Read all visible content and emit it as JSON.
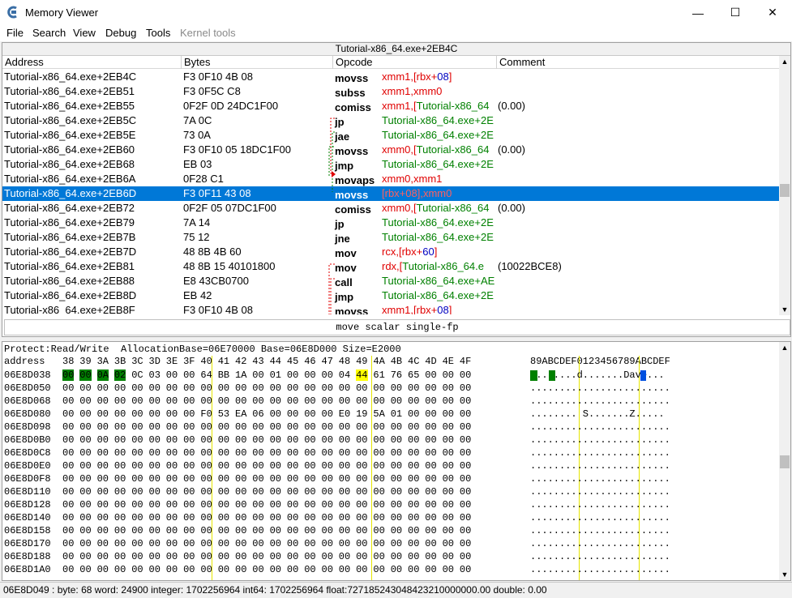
{
  "window": {
    "title": "Memory Viewer",
    "minimize": "—",
    "maximize": "☐",
    "close": "✕"
  },
  "menu": [
    "File",
    "Search",
    "View",
    "Debug",
    "Tools",
    "Kernel tools"
  ],
  "disasm": {
    "address_header": "Tutorial-x86_64.exe+2EB4C",
    "columns": [
      "Address",
      "Bytes",
      "Opcode",
      "Comment"
    ],
    "rows": [
      {
        "addr": "Tutorial-x86_64.exe+2EB4C",
        "bytes": "F3 0F10 4B 08",
        "op": "movss",
        "args": [
          {
            "t": "xmm1",
            "c": "red"
          },
          {
            "t": ",[",
            "c": "red"
          },
          {
            "t": "rbx",
            "c": "red"
          },
          {
            "t": "+",
            "c": "red"
          },
          {
            "t": "08",
            "c": "blue"
          },
          {
            "t": "]",
            "c": "red"
          }
        ],
        "rest": ""
      },
      {
        "addr": "Tutorial-x86_64.exe+2EB51",
        "bytes": "F3 0F5C C8",
        "op": "subss",
        "args": [
          {
            "t": "xmm1,xmm0",
            "c": "red"
          }
        ],
        "rest": ""
      },
      {
        "addr": "Tutorial-x86_64.exe+2EB55",
        "bytes": "0F2F 0D 24DC1F00",
        "op": "comiss",
        "args": [
          {
            "t": "xmm1,[",
            "c": "red"
          },
          {
            "t": "Tutorial-x86_64",
            "c": "green"
          }
        ],
        "rest": "(0.00)"
      },
      {
        "addr": "Tutorial-x86_64.exe+2EB5C",
        "bytes": "7A 0C",
        "op": "jp",
        "args": [
          {
            "t": "Tutorial-x86_64.exe+2E",
            "c": "green"
          }
        ],
        "rest": ""
      },
      {
        "addr": "Tutorial-x86_64.exe+2EB5E",
        "bytes": "73 0A",
        "op": "jae",
        "args": [
          {
            "t": "Tutorial-x86_64.exe+2E",
            "c": "green"
          }
        ],
        "rest": ""
      },
      {
        "addr": "Tutorial-x86_64.exe+2EB60",
        "bytes": "F3 0F10 05 18DC1F00",
        "op": "movss",
        "args": [
          {
            "t": "xmm0,[",
            "c": "red"
          },
          {
            "t": "Tutorial-x86_64",
            "c": "green"
          }
        ],
        "rest": "(0.00)"
      },
      {
        "addr": "Tutorial-x86_64.exe+2EB68",
        "bytes": "EB 03",
        "op": "jmp",
        "args": [
          {
            "t": "Tutorial-x86_64.exe+2E",
            "c": "green"
          }
        ],
        "rest": ""
      },
      {
        "addr": "Tutorial-x86_64.exe+2EB6A",
        "bytes": "0F28 C1",
        "op": "movaps",
        "args": [
          {
            "t": " xmm0,xmm1",
            "c": "red"
          }
        ],
        "rest": ""
      },
      {
        "addr": "Tutorial-x86_64.exe+2EB6D",
        "bytes": "F3 0F11 43 08",
        "op": "movss",
        "args": [
          {
            "t": "[rbx+08],xmm0",
            "c": "red"
          }
        ],
        "rest": "",
        "selected": true
      },
      {
        "addr": "Tutorial-x86_64.exe+2EB72",
        "bytes": "0F2F 05 07DC1F00",
        "op": "comiss",
        "args": [
          {
            "t": "xmm0,[",
            "c": "red"
          },
          {
            "t": "Tutorial-x86_64",
            "c": "green"
          }
        ],
        "rest": "(0.00)"
      },
      {
        "addr": "Tutorial-x86_64.exe+2EB79",
        "bytes": "7A 14",
        "op": "jp",
        "args": [
          {
            "t": "Tutorial-x86_64.exe+2E",
            "c": "green"
          }
        ],
        "rest": ""
      },
      {
        "addr": "Tutorial-x86_64.exe+2EB7B",
        "bytes": "75 12",
        "op": "jne",
        "args": [
          {
            "t": "Tutorial-x86_64.exe+2E",
            "c": "green"
          }
        ],
        "rest": ""
      },
      {
        "addr": "Tutorial-x86_64.exe+2EB7D",
        "bytes": "48 8B 4B 60",
        "op": "mov",
        "args": [
          {
            "t": "rcx,[",
            "c": "red"
          },
          {
            "t": "rbx",
            "c": "red"
          },
          {
            "t": "+",
            "c": "red"
          },
          {
            "t": "60",
            "c": "blue"
          },
          {
            "t": "]",
            "c": "red"
          }
        ],
        "rest": ""
      },
      {
        "addr": "Tutorial-x86_64.exe+2EB81",
        "bytes": "48 8B 15 40101800",
        "op": "mov",
        "args": [
          {
            "t": "rdx,[",
            "c": "red"
          },
          {
            "t": "Tutorial-x86_64.e",
            "c": "green"
          }
        ],
        "rest": "(10022BCE8)"
      },
      {
        "addr": "Tutorial-x86_64.exe+2EB88",
        "bytes": "E8 43CB0700",
        "op": "call",
        "args": [
          {
            "t": "Tutorial-x86_64.exe+AE",
            "c": "green"
          }
        ],
        "rest": ""
      },
      {
        "addr": "Tutorial-x86_64.exe+2EB8D",
        "bytes": "EB 42",
        "op": "jmp",
        "args": [
          {
            "t": "Tutorial-x86_64.exe+2E",
            "c": "green"
          }
        ],
        "rest": ""
      },
      {
        "addr": "Tutorial-x86_64.exe+2EB8F",
        "bytes": "F3 0F10 4B 08",
        "op": "movss",
        "args": [
          {
            "t": "xmm1,[",
            "c": "red"
          },
          {
            "t": "rbx",
            "c": "red"
          },
          {
            "t": "+",
            "c": "red"
          },
          {
            "t": "08",
            "c": "blue"
          },
          {
            "t": "]",
            "c": "red"
          }
        ],
        "rest": ""
      }
    ],
    "description": "move scalar single-fp"
  },
  "hexview": {
    "info": "Protect:Read/Write  AllocationBase=06E70000 Base=06E8D000 Size=E2000",
    "header_label": "address",
    "header_bytes": [
      "38",
      "39",
      "3A",
      "3B",
      "3C",
      "3D",
      "3E",
      "3F",
      "40",
      "41",
      "42",
      "43",
      "44",
      "45",
      "46",
      "47",
      "48",
      "49",
      "4A",
      "4B",
      "4C",
      "4D",
      "4E",
      "4F"
    ],
    "header_chars": "89ABCDEF0123456789ABCDEF",
    "rows": [
      {
        "addr": "06E8D038",
        "bytes": [
          "00",
          "00",
          "0A",
          "02",
          "0C",
          "03",
          "00",
          "00",
          "64",
          "BB",
          "1A",
          "00",
          "01",
          "00",
          "00",
          "00",
          "04",
          "44",
          "61",
          "76",
          "65",
          "00",
          "00",
          "00"
        ],
        "chars": "........d.......Dave..."
      },
      {
        "addr": "06E8D050",
        "bytes": [
          "00",
          "00",
          "00",
          "00",
          "00",
          "00",
          "00",
          "00",
          "00",
          "00",
          "00",
          "00",
          "00",
          "00",
          "00",
          "00",
          "00",
          "00",
          "00",
          "00",
          "00",
          "00",
          "00",
          "00"
        ],
        "chars": "........................"
      },
      {
        "addr": "06E8D068",
        "bytes": [
          "00",
          "00",
          "00",
          "00",
          "00",
          "00",
          "00",
          "00",
          "00",
          "00",
          "00",
          "00",
          "00",
          "00",
          "00",
          "00",
          "00",
          "00",
          "00",
          "00",
          "00",
          "00",
          "00",
          "00"
        ],
        "chars": "........................"
      },
      {
        "addr": "06E8D080",
        "bytes": [
          "00",
          "00",
          "00",
          "00",
          "00",
          "00",
          "00",
          "00",
          "F0",
          "53",
          "EA",
          "06",
          "00",
          "00",
          "00",
          "00",
          "E0",
          "19",
          "5A",
          "01",
          "00",
          "00",
          "00",
          "00"
        ],
        "chars": "........ S.......Z....."
      },
      {
        "addr": "06E8D098",
        "bytes": [
          "00",
          "00",
          "00",
          "00",
          "00",
          "00",
          "00",
          "00",
          "00",
          "00",
          "00",
          "00",
          "00",
          "00",
          "00",
          "00",
          "00",
          "00",
          "00",
          "00",
          "00",
          "00",
          "00",
          "00"
        ],
        "chars": "........................"
      },
      {
        "addr": "06E8D0B0",
        "bytes": [
          "00",
          "00",
          "00",
          "00",
          "00",
          "00",
          "00",
          "00",
          "00",
          "00",
          "00",
          "00",
          "00",
          "00",
          "00",
          "00",
          "00",
          "00",
          "00",
          "00",
          "00",
          "00",
          "00",
          "00"
        ],
        "chars": "........................"
      },
      {
        "addr": "06E8D0C8",
        "bytes": [
          "00",
          "00",
          "00",
          "00",
          "00",
          "00",
          "00",
          "00",
          "00",
          "00",
          "00",
          "00",
          "00",
          "00",
          "00",
          "00",
          "00",
          "00",
          "00",
          "00",
          "00",
          "00",
          "00",
          "00"
        ],
        "chars": "........................"
      },
      {
        "addr": "06E8D0E0",
        "bytes": [
          "00",
          "00",
          "00",
          "00",
          "00",
          "00",
          "00",
          "00",
          "00",
          "00",
          "00",
          "00",
          "00",
          "00",
          "00",
          "00",
          "00",
          "00",
          "00",
          "00",
          "00",
          "00",
          "00",
          "00"
        ],
        "chars": "........................"
      },
      {
        "addr": "06E8D0F8",
        "bytes": [
          "00",
          "00",
          "00",
          "00",
          "00",
          "00",
          "00",
          "00",
          "00",
          "00",
          "00",
          "00",
          "00",
          "00",
          "00",
          "00",
          "00",
          "00",
          "00",
          "00",
          "00",
          "00",
          "00",
          "00"
        ],
        "chars": "........................"
      },
      {
        "addr": "06E8D110",
        "bytes": [
          "00",
          "00",
          "00",
          "00",
          "00",
          "00",
          "00",
          "00",
          "00",
          "00",
          "00",
          "00",
          "00",
          "00",
          "00",
          "00",
          "00",
          "00",
          "00",
          "00",
          "00",
          "00",
          "00",
          "00"
        ],
        "chars": "........................"
      },
      {
        "addr": "06E8D128",
        "bytes": [
          "00",
          "00",
          "00",
          "00",
          "00",
          "00",
          "00",
          "00",
          "00",
          "00",
          "00",
          "00",
          "00",
          "00",
          "00",
          "00",
          "00",
          "00",
          "00",
          "00",
          "00",
          "00",
          "00",
          "00"
        ],
        "chars": "........................"
      },
      {
        "addr": "06E8D140",
        "bytes": [
          "00",
          "00",
          "00",
          "00",
          "00",
          "00",
          "00",
          "00",
          "00",
          "00",
          "00",
          "00",
          "00",
          "00",
          "00",
          "00",
          "00",
          "00",
          "00",
          "00",
          "00",
          "00",
          "00",
          "00"
        ],
        "chars": "........................"
      },
      {
        "addr": "06E8D158",
        "bytes": [
          "00",
          "00",
          "00",
          "00",
          "00",
          "00",
          "00",
          "00",
          "00",
          "00",
          "00",
          "00",
          "00",
          "00",
          "00",
          "00",
          "00",
          "00",
          "00",
          "00",
          "00",
          "00",
          "00",
          "00"
        ],
        "chars": "........................"
      },
      {
        "addr": "06E8D170",
        "bytes": [
          "00",
          "00",
          "00",
          "00",
          "00",
          "00",
          "00",
          "00",
          "00",
          "00",
          "00",
          "00",
          "00",
          "00",
          "00",
          "00",
          "00",
          "00",
          "00",
          "00",
          "00",
          "00",
          "00",
          "00"
        ],
        "chars": "........................"
      },
      {
        "addr": "06E8D188",
        "bytes": [
          "00",
          "00",
          "00",
          "00",
          "00",
          "00",
          "00",
          "00",
          "00",
          "00",
          "00",
          "00",
          "00",
          "00",
          "00",
          "00",
          "00",
          "00",
          "00",
          "00",
          "00",
          "00",
          "00",
          "00"
        ],
        "chars": "........................"
      },
      {
        "addr": "06E8D1A0",
        "bytes": [
          "00",
          "00",
          "00",
          "00",
          "00",
          "00",
          "00",
          "00",
          "00",
          "00",
          "00",
          "00",
          "00",
          "00",
          "00",
          "00",
          "00",
          "00",
          "00",
          "00",
          "00",
          "00",
          "00",
          "00"
        ],
        "chars": "........................"
      }
    ]
  },
  "status": "06E8D049 : byte: 68 word: 24900 integer: 1702256964 int64: 1702256964 float:727185243048423210000000.00 double: 0.00",
  "colors": {
    "selection": "#0078d7",
    "register": "#e00000",
    "offset": "#0000c0",
    "symbol": "#008000",
    "byte_changed": "#008000",
    "byte_selected": "#ffff00"
  }
}
